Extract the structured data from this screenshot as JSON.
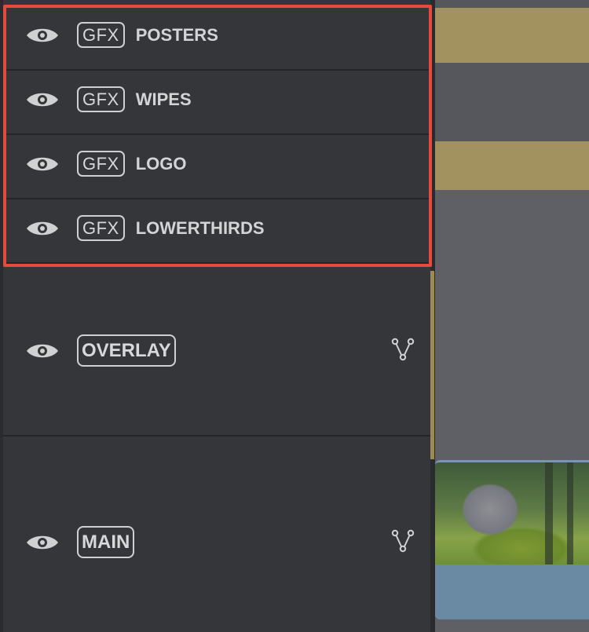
{
  "tracks": [
    {
      "id": "posters",
      "badge": "GFX",
      "name": "POSTERS"
    },
    {
      "id": "wipes",
      "badge": "GFX",
      "name": "WIPES"
    },
    {
      "id": "logo",
      "badge": "GFX",
      "name": "LOGO"
    },
    {
      "id": "lowerthirds",
      "badge": "GFX",
      "name": "LOWERTHIRDS"
    },
    {
      "id": "overlay",
      "badge": "OVERLAY"
    },
    {
      "id": "main",
      "badge": "MAIN"
    }
  ],
  "icons": {
    "visibility": "eye-icon",
    "branch": "branch-icon"
  },
  "colors": {
    "highlight": "#e54a3c",
    "gfx_clip": "#a1925f",
    "video_clip": "#5c7b96"
  }
}
